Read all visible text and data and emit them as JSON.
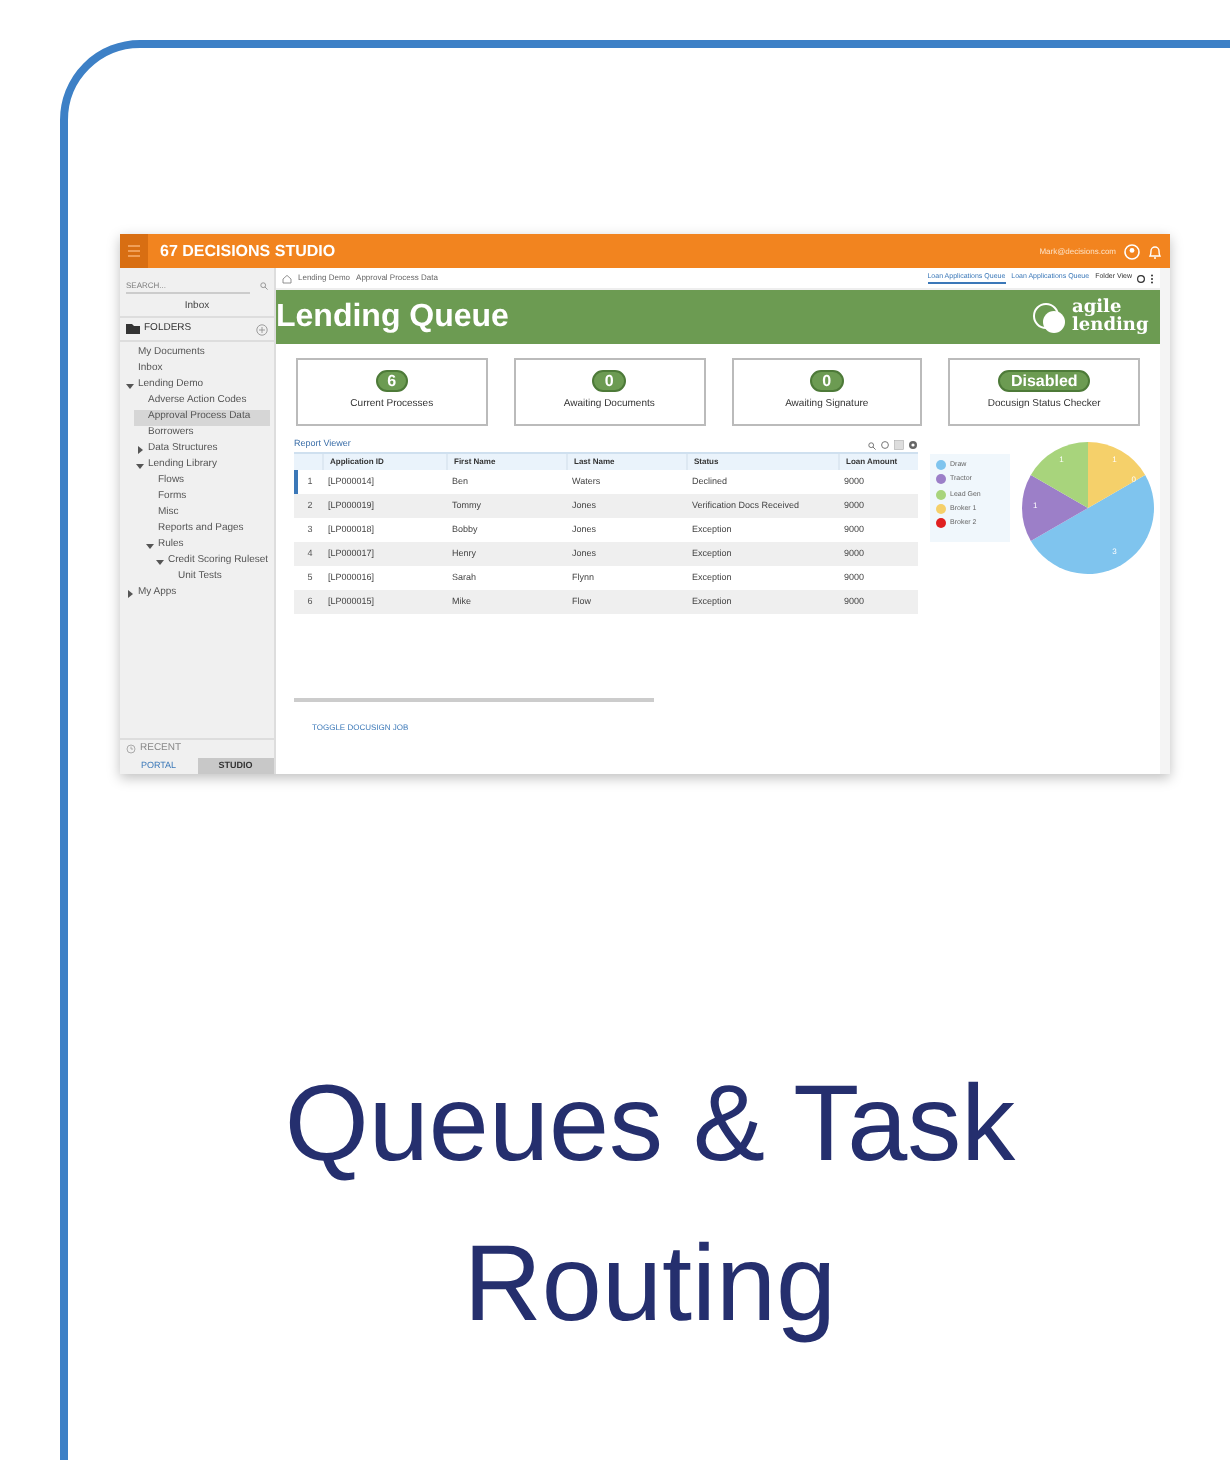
{
  "app": {
    "brand": "67 DECISIONS STUDIO",
    "user_email": "Mark@decisions.com"
  },
  "sidebar": {
    "search": {
      "placeholder": "SEARCH..."
    },
    "inbox_button": "Inbox",
    "folders_label": "FOLDERS",
    "tree": [
      {
        "label": "My Documents",
        "selected": false
      },
      {
        "label": "Inbox",
        "selected": false
      },
      {
        "label": "Lending Demo",
        "selected": false,
        "expanded": true,
        "children": [
          {
            "label": "Adverse Action Codes",
            "selected": false
          },
          {
            "label": "Approval Process Data",
            "selected": true
          },
          {
            "label": "Borrowers",
            "selected": false
          },
          {
            "label": "Data Structures",
            "selected": false,
            "expanded": false
          },
          {
            "label": "Lending Library",
            "selected": false,
            "expanded": true,
            "children": [
              {
                "label": "Flows",
                "selected": false
              },
              {
                "label": "Forms",
                "selected": false
              },
              {
                "label": "Misc",
                "selected": false
              },
              {
                "label": "Reports and Pages",
                "selected": false
              },
              {
                "label": "Rules",
                "selected": false,
                "expanded": true,
                "children": [
                  {
                    "label": "Credit Scoring Ruleset",
                    "selected": false,
                    "expanded": true,
                    "children": [
                      {
                        "label": "Unit Tests",
                        "selected": false
                      }
                    ]
                  }
                ]
              }
            ]
          }
        ]
      },
      {
        "label": "My Apps",
        "selected": false,
        "expanded": false
      }
    ],
    "recent_label": "RECENT",
    "mode_tabs": [
      {
        "label": "PORTAL",
        "selected": false
      },
      {
        "label": "STUDIO",
        "selected": true
      }
    ]
  },
  "breadcrumb": [
    "Lending Demo",
    "Approval Process Data"
  ],
  "view_tabs": [
    {
      "label": "Loan Applications Queue",
      "selected": true
    },
    {
      "label": "Loan Applications Queue",
      "selected": false
    },
    {
      "label": "Folder View",
      "selected": false
    }
  ],
  "banner": {
    "title": "Lending Queue",
    "logo_line_1": "agile",
    "logo_line_2": "lending"
  },
  "stats": [
    {
      "value": "6",
      "label": "Current Processes"
    },
    {
      "value": "0",
      "label": "Awaiting Documents"
    },
    {
      "value": "0",
      "label": "Awaiting Signature"
    },
    {
      "value": "Disabled",
      "label": "Docusign Status Checker"
    }
  ],
  "report": {
    "title": "Report Viewer",
    "columns": [
      "Application ID",
      "First Name",
      "Last Name",
      "Status",
      "Loan Amount"
    ],
    "rows": [
      {
        "number": "1",
        "cells": [
          "[LP000014]",
          "Ben",
          "Waters",
          "Declined",
          "9000"
        ],
        "selected": true
      },
      {
        "number": "2",
        "cells": [
          "[LP000019]",
          "Tommy",
          "Jones",
          "Verification Docs Received",
          "9000"
        ],
        "selected": false
      },
      {
        "number": "3",
        "cells": [
          "[LP000018]",
          "Bobby",
          "Jones",
          "Exception",
          "9000"
        ],
        "selected": false
      },
      {
        "number": "4",
        "cells": [
          "[LP000017]",
          "Henry",
          "Jones",
          "Exception",
          "9000"
        ],
        "selected": false
      },
      {
        "number": "5",
        "cells": [
          "[LP000016]",
          "Sarah",
          "Flynn",
          "Exception",
          "9000"
        ],
        "selected": false
      },
      {
        "number": "6",
        "cells": [
          "[LP000015]",
          "Mike",
          "Flow",
          "Exception",
          "9000"
        ],
        "selected": false
      }
    ]
  },
  "pie": {
    "chart_data": {
      "type": "pie",
      "categories": [
        "Draw",
        "Tractor",
        "Lead Gen",
        "Broker 1",
        "Broker 2"
      ],
      "values": [
        3,
        1,
        1,
        1,
        0
      ],
      "colors": [
        "#7fc4ee",
        "#9c7fc8",
        "#a8d47c",
        "#f5d06a",
        "#e02020"
      ],
      "value_labels": [
        "3",
        "1",
        "1",
        "1",
        "0"
      ],
      "legend": "left"
    }
  },
  "footer_link": "TOGGLE DOCUSIGN JOB",
  "card_title": "Queues & Task Routing"
}
